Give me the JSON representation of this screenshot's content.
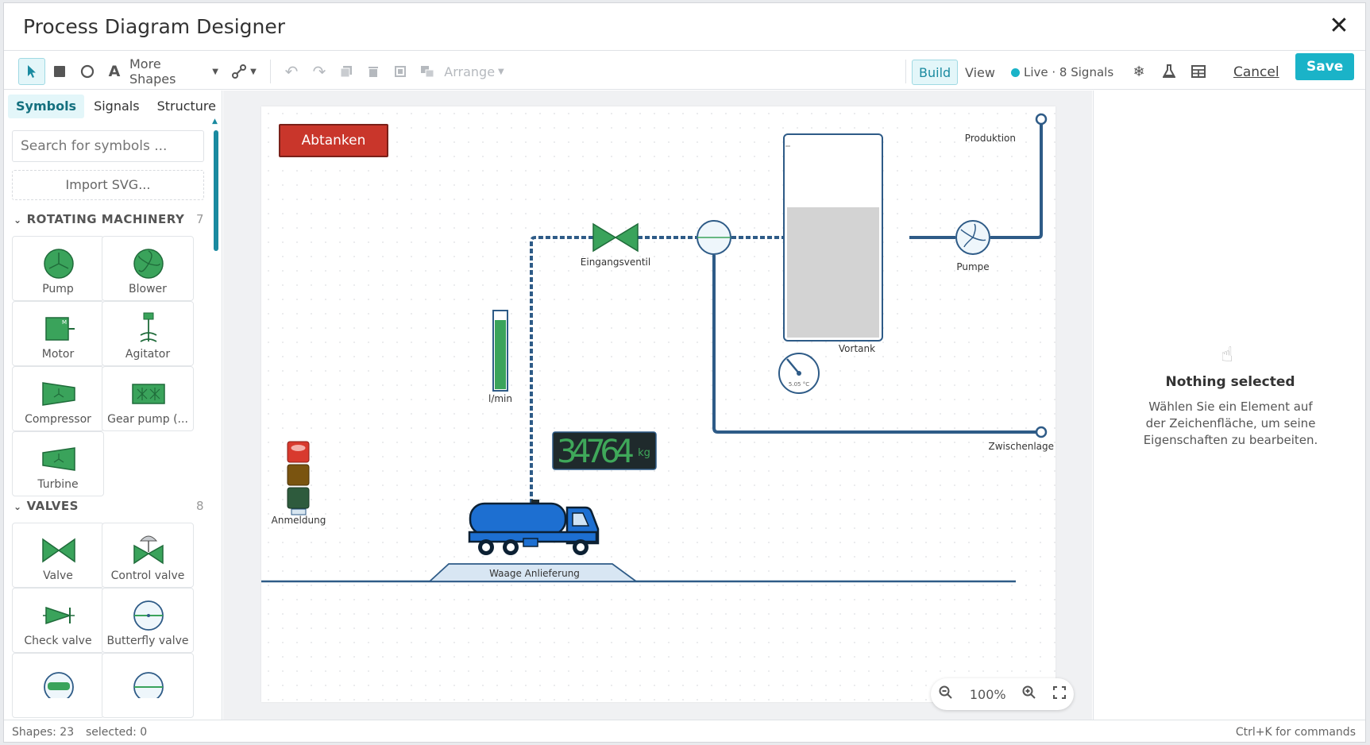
{
  "window": {
    "title": "Process Diagram Designer"
  },
  "toolbar": {
    "more_shapes": "More Shapes",
    "arrange": "Arrange",
    "build": "Build",
    "view": "View",
    "live": "Live · 8 Signals",
    "cancel": "Cancel",
    "save": "Save"
  },
  "left_panel": {
    "tabs": [
      "Symbols",
      "Signals",
      "Structure"
    ],
    "search_placeholder": "Search for symbols ...",
    "import": "Import SVG...",
    "sections": [
      {
        "title": "ROTATING MACHINERY",
        "count": "7",
        "items": [
          "Pump",
          "Blower",
          "Motor",
          "Agitator",
          "Compressor",
          "Gear pump (...",
          "Turbine"
        ]
      },
      {
        "title": "VALVES",
        "count": "8",
        "items": [
          "Valve",
          "Control valve",
          "Check valve",
          "Butterfly valve"
        ]
      }
    ]
  },
  "diagram": {
    "button": "Abtanken",
    "labels": {
      "valve": "Eingangsventil",
      "pump": "Pumpe",
      "tank": "Vortank",
      "out1": "Produktion",
      "out2": "Zwischenlage",
      "flow": "l/min",
      "display_unit": "kg",
      "display_value": "34764",
      "gauge": "5.05 °C",
      "light": "Anmeldung",
      "scale": "Waage Anlieferung"
    },
    "tank_level_fraction": 0.64,
    "flow_level_fraction": 0.9,
    "colors": {
      "pipe": "#2e5b87",
      "green": "#3aa35b",
      "button": "#c9362b"
    }
  },
  "zoom": {
    "value": "100%"
  },
  "right_panel": {
    "title": "Nothing selected",
    "text": "Wählen Sie ein Element auf der Zeichenfläche, um seine Eigenschaften zu bearbeiten."
  },
  "status": {
    "shapes": "Shapes: 23",
    "selected": "selected: 0",
    "hint": "Ctrl+K for commands"
  }
}
